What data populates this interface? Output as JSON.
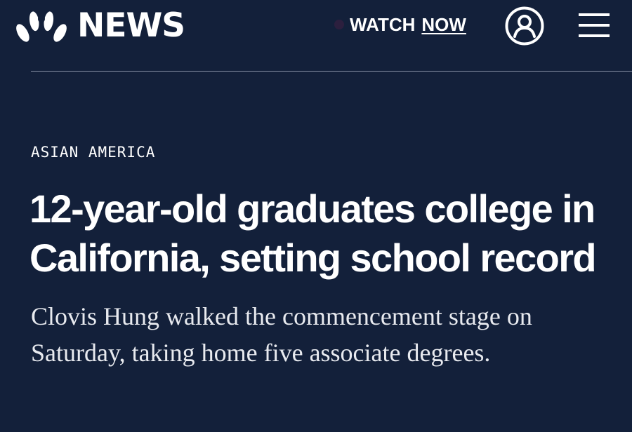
{
  "header": {
    "brand": "NEWS",
    "watch_label": "WATCH",
    "watch_now": "NOW",
    "colors": {
      "background": "#13203a",
      "text": "#ffffff",
      "divider": "#8892a6"
    },
    "icons": {
      "logo": "nbc-peacock-icon",
      "live": "live-dot-icon",
      "account": "user-account-icon",
      "menu": "hamburger-menu-icon"
    }
  },
  "article": {
    "section": "ASIAN AMERICA",
    "headline": "12-year-old graduates college in California, setting school record",
    "dek": "Clovis Hung walked the commencement stage on Saturday, taking home five associate degrees."
  }
}
